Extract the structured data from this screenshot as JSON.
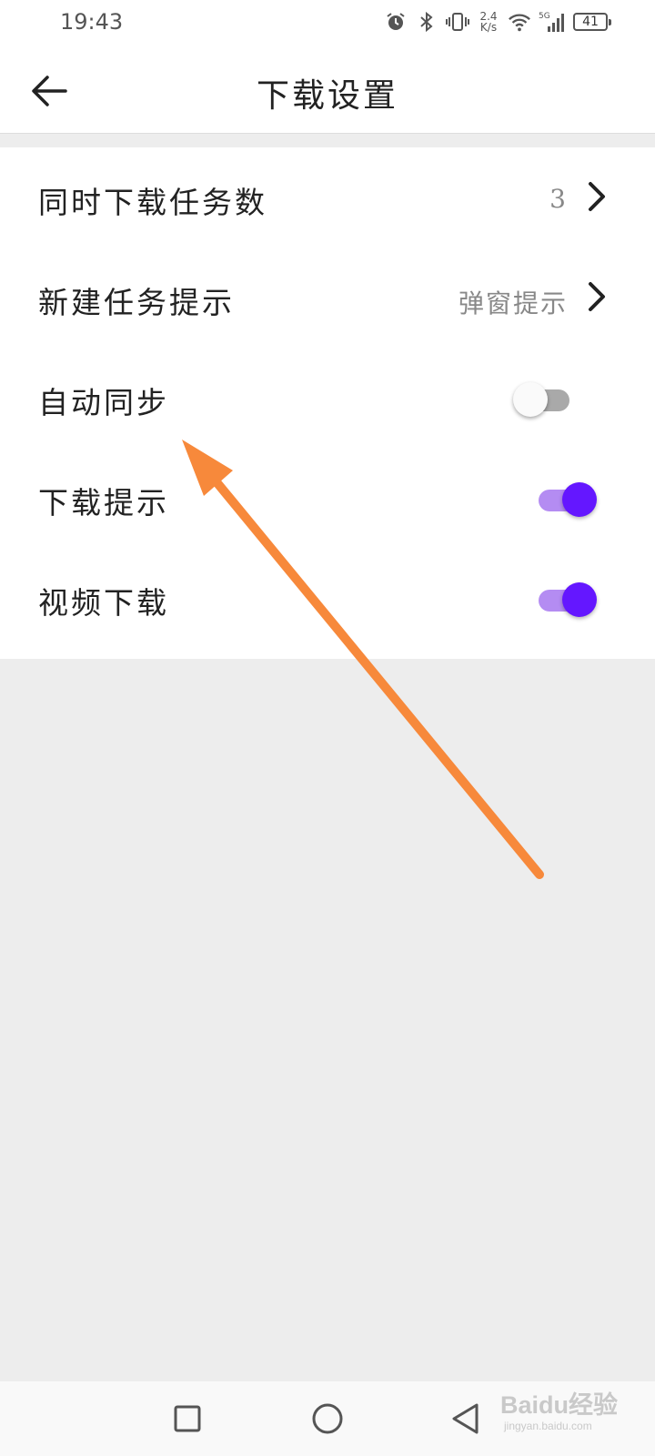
{
  "status_bar": {
    "time": "19:43",
    "speed_top": "2.4",
    "speed_bottom": "K/s",
    "network": "5G",
    "battery": "41",
    "icons": [
      "alarm-icon",
      "bluetooth-icon",
      "vibrate-icon",
      "wifi-icon",
      "signal-icon",
      "battery-icon"
    ]
  },
  "header": {
    "title": "下载设置",
    "back_icon": "arrow-left-icon"
  },
  "settings": {
    "items": [
      {
        "label": "同时下载任务数",
        "value": "3",
        "control": "chevron"
      },
      {
        "label": "新建任务提示",
        "value": "弹窗提示",
        "control": "chevron"
      },
      {
        "label": "自动同步",
        "control": "toggle",
        "on": false
      },
      {
        "label": "下载提示",
        "control": "toggle",
        "on": true
      },
      {
        "label": "视频下载",
        "control": "toggle",
        "on": true
      }
    ]
  },
  "colors": {
    "accent": "#6417ff",
    "accent_track": "#b48cf2",
    "annotation_arrow": "#f7893b",
    "background": "#ededed"
  },
  "nav_bar": {
    "icons": [
      "recent-apps-icon",
      "home-icon",
      "back-triangle-icon"
    ]
  },
  "watermark": {
    "main": "Baidu经验",
    "sub": "jingyan.baidu.com"
  }
}
